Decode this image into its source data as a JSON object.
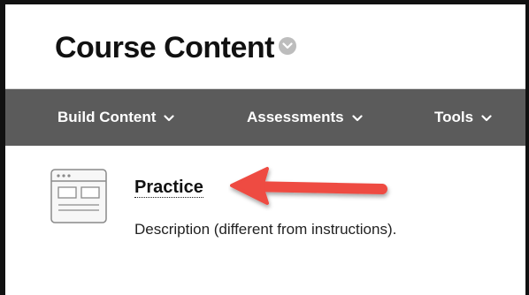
{
  "page": {
    "title": "Course Content",
    "title_menu_icon": "chevron-down-circle-icon"
  },
  "toolbar": {
    "items": [
      {
        "label": "Build Content",
        "icon": "chevron-down-icon"
      },
      {
        "label": "Assessments",
        "icon": "chevron-down-icon"
      },
      {
        "label": "Tools",
        "icon": "chevron-down-icon"
      }
    ],
    "background_color": "#5b5b5b",
    "text_color": "#ffffff"
  },
  "content": {
    "items": [
      {
        "icon": "item-document-icon",
        "title": "Practice",
        "description": "Description (different from instructions)."
      }
    ]
  },
  "annotation": {
    "icon": "red-arrow-icon",
    "color": "#ee4b43"
  }
}
